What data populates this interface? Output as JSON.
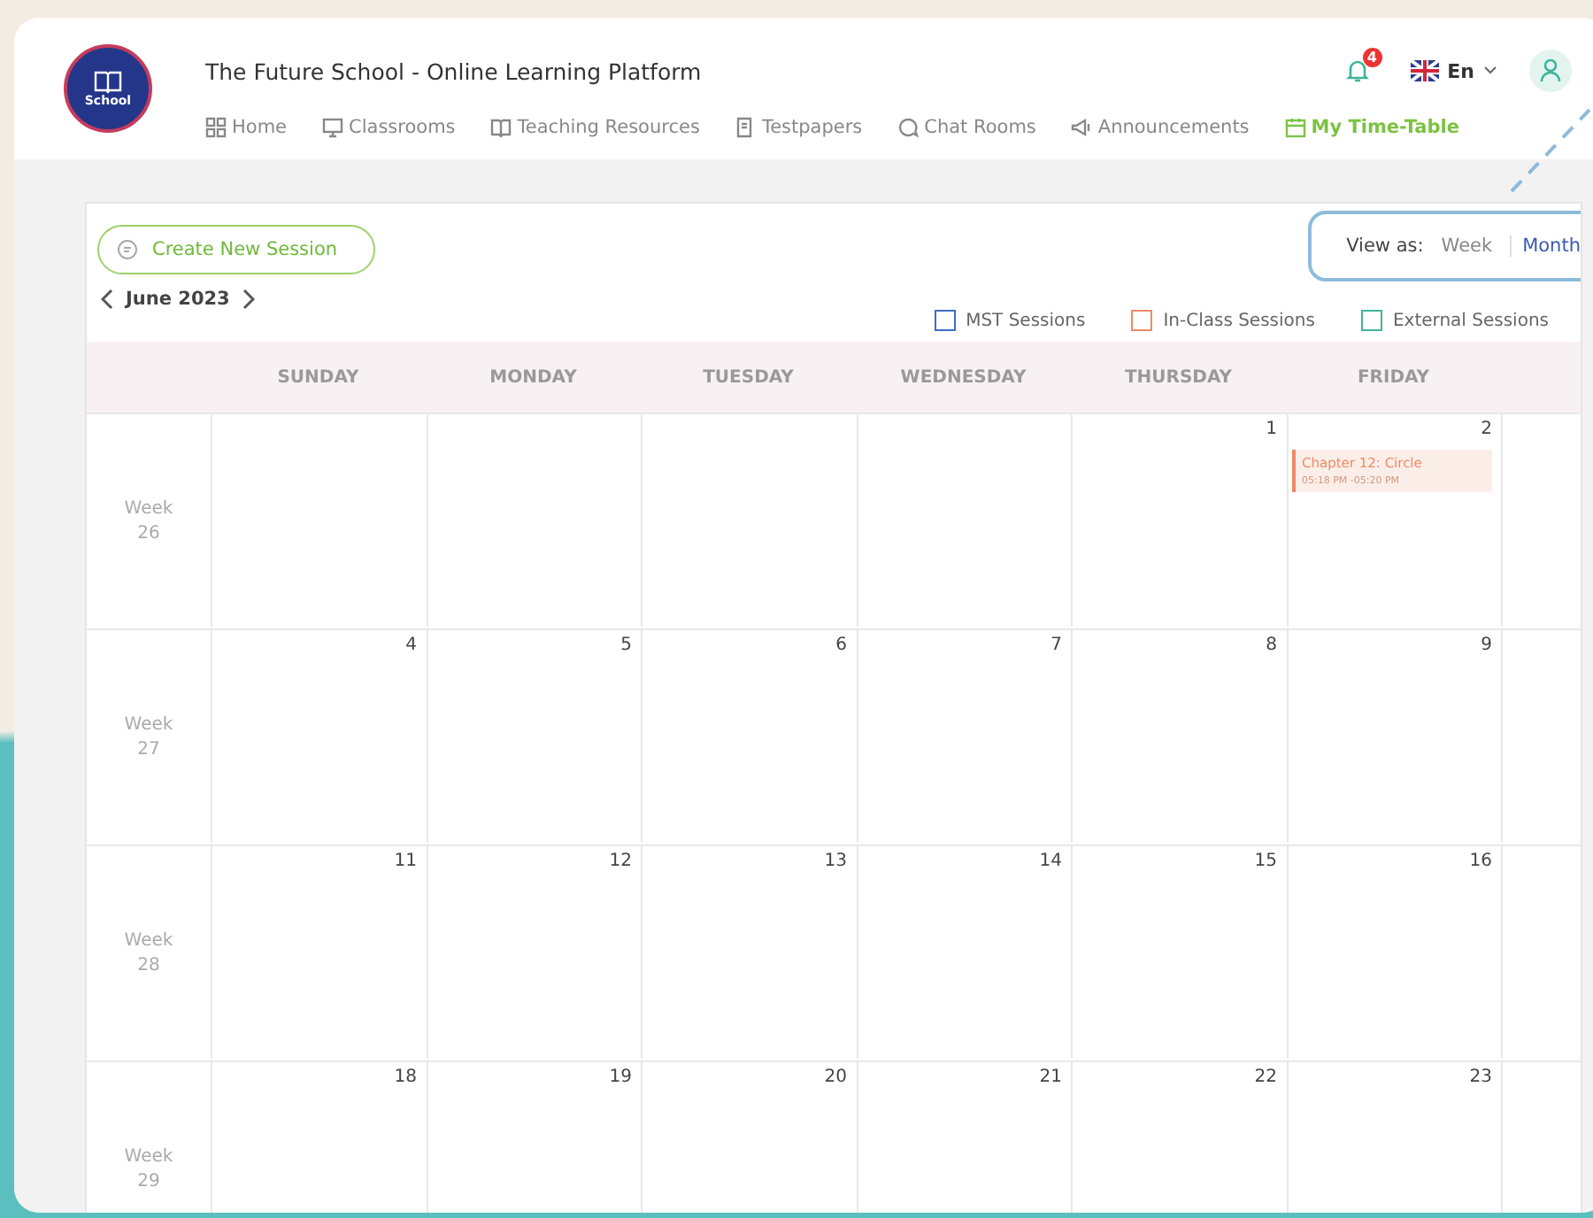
{
  "header": {
    "logo_text": "School",
    "title": "The Future School - Online Learning Platform",
    "notification_count": "4",
    "language": "En"
  },
  "nav": [
    {
      "label": "Home",
      "selected": false
    },
    {
      "label": "Classrooms",
      "selected": false
    },
    {
      "label": "Teaching Resources",
      "selected": false
    },
    {
      "label": "Testpapers",
      "selected": false
    },
    {
      "label": "Chat Rooms",
      "selected": false
    },
    {
      "label": "Announcements",
      "selected": false
    },
    {
      "label": "My Time-Table",
      "selected": true
    }
  ],
  "create_button": "Create New Session",
  "month": "June 2023",
  "view_as": {
    "label": "View as:",
    "options": [
      {
        "label": "Week",
        "selected": false
      },
      {
        "label": "Month",
        "selected": true
      }
    ]
  },
  "legend": [
    {
      "label": "MST Sessions",
      "color": "#3b6fc4"
    },
    {
      "label": "In-Class Sessions",
      "color": "#ee8a66"
    },
    {
      "label": "External Sessions",
      "color": "#3fb59a"
    }
  ],
  "weekdays": [
    "SUNDAY",
    "MONDAY",
    "TUESDAY",
    "WEDNESDAY",
    "THURSDAY",
    "FRIDAY"
  ],
  "weeks": [
    {
      "label": "Week",
      "number": "26",
      "days": [
        {
          "kind": "blank"
        },
        {
          "kind": "blank"
        },
        {
          "kind": "blank"
        },
        {
          "kind": "blank"
        },
        {
          "kind": "date",
          "date": "1"
        },
        {
          "kind": "date",
          "date": "2",
          "sessions": [
            {
              "title": "Chapter 12: Circle",
              "time": "05:18 PM -05:20 PM",
              "color": "#ee8a66"
            }
          ]
        },
        {
          "kind": "blank"
        }
      ]
    },
    {
      "label": "Week",
      "number": "27",
      "days": [
        {
          "kind": "date",
          "date": "4"
        },
        {
          "kind": "date",
          "date": "5"
        },
        {
          "kind": "date",
          "date": "6"
        },
        {
          "kind": "date",
          "date": "7"
        },
        {
          "kind": "date",
          "date": "8"
        },
        {
          "kind": "date",
          "date": "9"
        },
        {
          "kind": "blank"
        }
      ]
    },
    {
      "label": "Week",
      "number": "28",
      "days": [
        {
          "kind": "date",
          "date": "11"
        },
        {
          "kind": "date",
          "date": "12"
        },
        {
          "kind": "date",
          "date": "13"
        },
        {
          "kind": "date",
          "date": "14"
        },
        {
          "kind": "date",
          "date": "15"
        },
        {
          "kind": "date",
          "date": "16"
        },
        {
          "kind": "blank"
        }
      ]
    },
    {
      "label": "Week",
      "number": "29",
      "days": [
        {
          "kind": "date",
          "date": "18"
        },
        {
          "kind": "date",
          "date": "19"
        },
        {
          "kind": "date",
          "date": "20"
        },
        {
          "kind": "date",
          "date": "21"
        },
        {
          "kind": "date",
          "date": "22"
        },
        {
          "kind": "date",
          "date": "23"
        },
        {
          "kind": "blank"
        }
      ]
    }
  ]
}
